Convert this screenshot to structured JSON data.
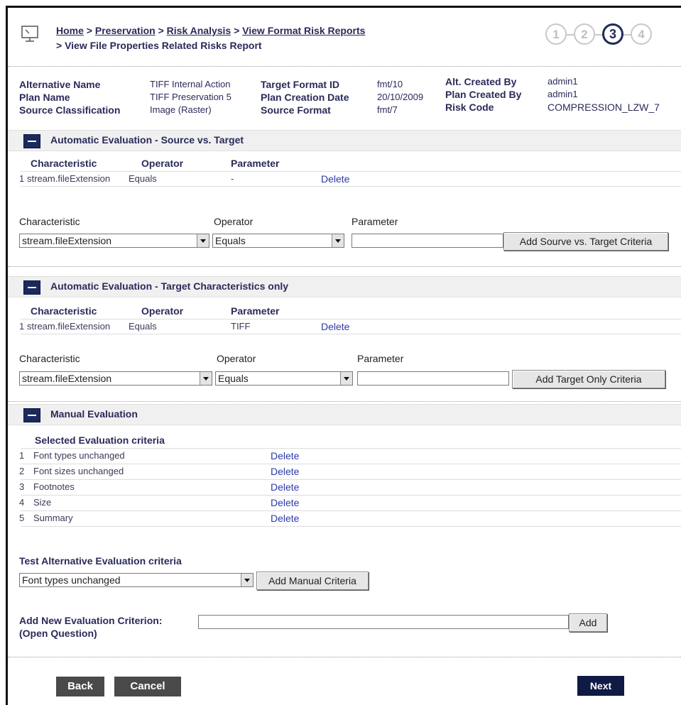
{
  "breadcrumb": {
    "home": "Home",
    "preservation": "Preservation",
    "risk_analysis": "Risk Analysis",
    "view_format_risk_reports": "View Format Risk Reports",
    "sep": ">",
    "current": "> View File Properties Related  Risks Report"
  },
  "steps": [
    "1",
    "2",
    "3",
    "4"
  ],
  "active_step": 3,
  "meta": {
    "alternative_name_label": "Alternative Name",
    "alternative_name": "TIFF Internal Action",
    "plan_name_label": "Plan Name",
    "plan_name": "TIFF Preservation 5",
    "source_classification_label": "Source Classification",
    "source_classification": "Image (Raster)",
    "target_format_id_label": "Target Format ID",
    "target_format_id": "fmt/10",
    "plan_creation_date_label": "Plan Creation Date",
    "plan_creation_date": "20/10/2009",
    "source_format_label": "Source Format",
    "source_format": "fmt/7",
    "alt_created_by_label": "Alt. Created By",
    "alt_created_by": "admin1",
    "plan_created_by_label": "Plan Created By",
    "plan_created_by": "admin1",
    "risk_code_label": "Risk Code",
    "risk_code": "COMPRESSION_LZW_7"
  },
  "source_vs_target": {
    "title": "Automatic Evaluation - Source vs. Target",
    "headers": [
      "Characteristic",
      "Operator",
      "Parameter"
    ],
    "rows": [
      {
        "index": "1",
        "characteristic": "stream.fileExtension",
        "operator": "Equals",
        "parameter": "-",
        "action": "Delete"
      }
    ],
    "form": {
      "characteristic_label": "Characteristic",
      "operator_label": "Operator",
      "parameter_label": "Parameter",
      "characteristic_value": "stream.fileExtension",
      "operator_value": "Equals",
      "parameter_value": "",
      "add_button": "Add Sourve vs. Target Criteria"
    }
  },
  "target_only": {
    "title": "Automatic Evaluation - Target Characteristics only",
    "headers": [
      "Characteristic",
      "Operator",
      "Parameter"
    ],
    "rows": [
      {
        "index": "1",
        "characteristic": "stream.fileExtension",
        "operator": "Equals",
        "parameter": "TIFF",
        "action": "Delete"
      }
    ],
    "form": {
      "characteristic_label": "Characteristic",
      "operator_label": "Operator",
      "parameter_label": "Parameter",
      "characteristic_value": "stream.fileExtension",
      "operator_value": "Equals",
      "parameter_value": "",
      "add_button": "Add Target Only Criteria"
    }
  },
  "manual": {
    "title": "Manual Evaluation",
    "selected_header": "Selected Evaluation criteria",
    "criteria": [
      {
        "index": "1",
        "name": "Font types unchanged",
        "action": "Delete"
      },
      {
        "index": "2",
        "name": "Font sizes unchanged",
        "action": "Delete"
      },
      {
        "index": "3",
        "name": "Footnotes",
        "action": "Delete"
      },
      {
        "index": "4",
        "name": "Size",
        "action": "Delete"
      },
      {
        "index": "5",
        "name": "Summary",
        "action": "Delete"
      }
    ],
    "test_label": "Test Alternative Evaluation criteria",
    "test_select_value": "Font types unchanged",
    "add_manual_button": "Add Manual Criteria",
    "new_criterion_label": "Add New Evaluation Criterion:",
    "new_criterion_sublabel": "(Open Question)",
    "new_criterion_value": "",
    "add_button": "Add"
  },
  "footer": {
    "back": "Back",
    "cancel": "Cancel",
    "next": "Next"
  },
  "colors": {
    "navy": "#1b2a5e",
    "link": "#2b3aa8",
    "section_bg": "#f0f0f0",
    "dark_button": "#4a4a4a"
  }
}
